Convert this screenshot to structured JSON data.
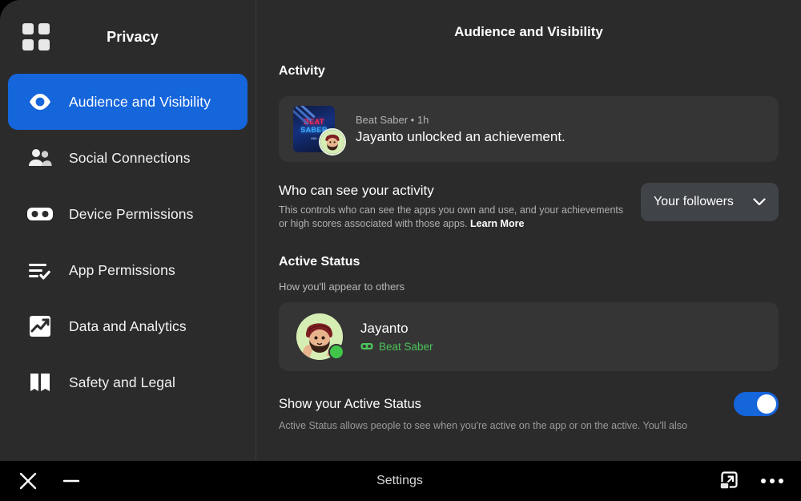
{
  "window": {
    "sidebar": {
      "app_icon": "grid-icon",
      "title": "Privacy",
      "items": [
        {
          "label": "Audience and Visibility",
          "icon": "eye-icon",
          "active": true
        },
        {
          "label": "Social Connections",
          "icon": "people-icon",
          "active": false
        },
        {
          "label": "Device Permissions",
          "icon": "vr-headset-icon",
          "active": false
        },
        {
          "label": "App Permissions",
          "icon": "list-check-icon",
          "active": false
        },
        {
          "label": "Data and Analytics",
          "icon": "analytics-chart-icon",
          "active": false
        },
        {
          "label": "Safety and Legal",
          "icon": "book-icon",
          "active": false
        }
      ]
    },
    "main": {
      "header_title": "Audience and Visibility",
      "activity": {
        "section_title": "Activity",
        "card": {
          "app_name": "Beat Saber",
          "separator": "•",
          "time": "1h",
          "message": "Jayanto unlocked an achievement.",
          "thumb_line1": "BEAT",
          "thumb_line2": "SABER",
          "thumb_line3": "360"
        }
      },
      "visibility_setting": {
        "title": "Who can see your activity",
        "description": "This controls who can see the apps you own and use, and your achievements or high scores associated with those apps.",
        "learn_more": "Learn More",
        "dropdown_value": "Your followers"
      },
      "active_status": {
        "section_title": "Active Status",
        "sub_label": "How you'll appear to others",
        "user_name": "Jayanto",
        "user_game": "Beat Saber",
        "toggle_title": "Show your Active Status",
        "toggle_on": true,
        "toggle_description": "Active Status allows people to see when you're active on the app or on the active. You'll also"
      }
    }
  },
  "taskbar": {
    "close_label": "close-icon",
    "minimize_label": "minimize-icon",
    "title": "Settings",
    "popout_label": "popout-icon",
    "more_label": "more-icon"
  },
  "colors": {
    "accent_blue": "#1565db",
    "online_green": "#42c64a",
    "panel": "#2b2b2b",
    "card": "#353535"
  }
}
